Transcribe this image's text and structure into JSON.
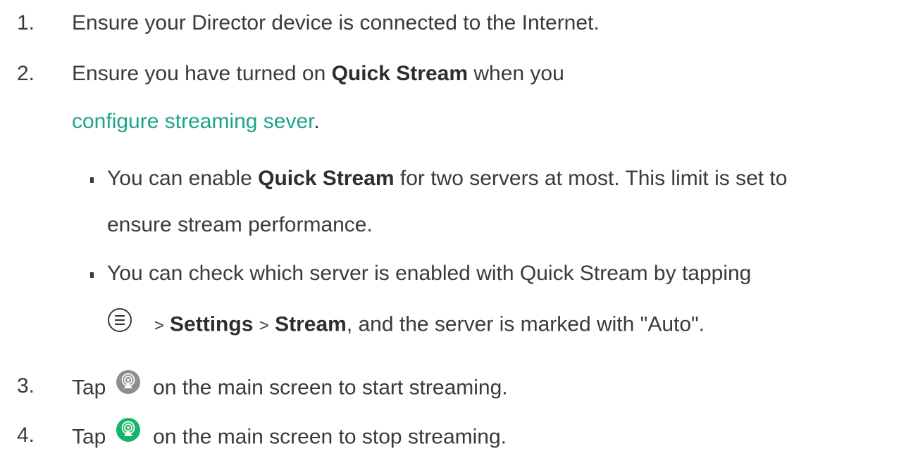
{
  "steps": {
    "s1": {
      "number": "1.",
      "text": "Ensure your Director device is connected to the Internet."
    },
    "s2": {
      "number": "2.",
      "pre": "Ensure you have turned on",
      "bold": "Quick Stream",
      "post": "when you",
      "link": "configure streaming sever",
      "end": "."
    },
    "b1": {
      "pre": "You can enable",
      "bold": "Quick Stream",
      "post": "for two servers at most. This limit is set to",
      "line2": "ensure stream performance."
    },
    "b2": {
      "line1": "You can check which server is enabled with Quick Stream by tapping",
      "sep1": ">",
      "settings": "Settings",
      "sep2": ">",
      "stream": "Stream",
      "post": ", and the server is marked with \"Auto\".",
      "icon": "menu-circle-icon"
    },
    "s3": {
      "number": "3.",
      "tap": "Tap",
      "post": "on the main screen to start streaming.",
      "icon": "stream-gray-icon"
    },
    "s4": {
      "number": "4.",
      "tap": "Tap",
      "post": "on the main screen to stop streaming.",
      "icon": "stream-green-icon"
    }
  },
  "colors": {
    "text": "#3a3a3a",
    "link": "#1fa38a",
    "icon_gray": "#8e8e8e",
    "icon_green": "#16b36b"
  }
}
